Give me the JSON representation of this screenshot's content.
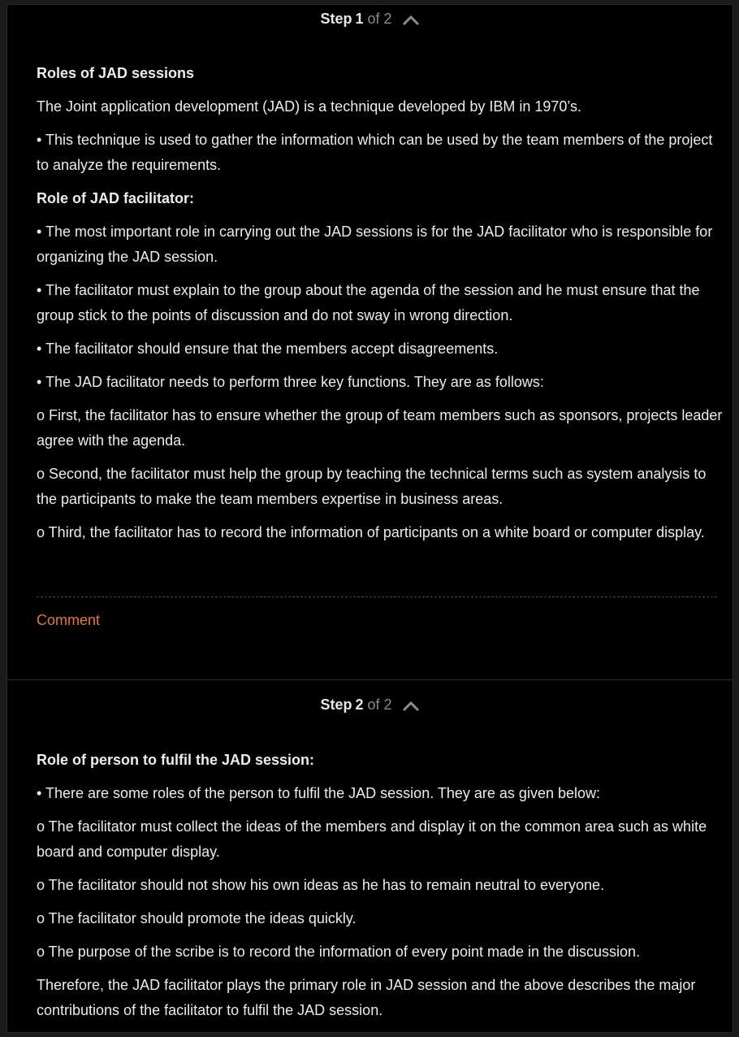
{
  "step1": {
    "step_word": "Step",
    "step_num": "1",
    "step_of": "of 2",
    "paragraphs": [
      {
        "text": "Roles of JAD sessions",
        "bold": true
      },
      {
        "text": "The Joint application development (JAD) is a technique developed by IBM in 1970’s.",
        "bold": false
      },
      {
        "text": "• This technique is used to gather the information which can be used by the team members of the project to analyze the requirements.",
        "bold": false
      },
      {
        "text": "Role of JAD facilitator:",
        "bold": true
      },
      {
        "text": "• The most important role in carrying out the JAD sessions is for the JAD facilitator who is responsible for organizing the JAD session.",
        "bold": false
      },
      {
        "text": "• The facilitator must explain to the group about the agenda of the session and he must ensure that the group stick to the points of discussion and do not sway in wrong direction.",
        "bold": false
      },
      {
        "text": "• The facilitator should ensure that the members accept disagreements.",
        "bold": false
      },
      {
        "text": "• The JAD facilitator needs to perform three key functions. They are as follows:",
        "bold": false
      },
      {
        "text": "o First, the facilitator has to ensure whether the group of team members such as sponsors, projects leader agree with the agenda.",
        "bold": false
      },
      {
        "text": "o Second, the facilitator must help the group by teaching the technical terms such as system analysis to the participants to make the team members expertise in business areas.",
        "bold": false
      },
      {
        "text": "o Third, the facilitator has to record the information of participants on a white board or computer display.",
        "bold": false
      }
    ],
    "comment_label": "Comment"
  },
  "step2": {
    "step_word": "Step",
    "step_num": "2",
    "step_of": "of 2",
    "paragraphs": [
      {
        "text": "Role of person to fulfil the JAD session:",
        "bold": true
      },
      {
        "text": "• There are some roles of the person to fulfil the JAD session. They are as given below:",
        "bold": false
      },
      {
        "text": "o The facilitator must collect the ideas of the members and display it on the common area such as white board and computer display.",
        "bold": false
      },
      {
        "text": "o The facilitator should not show his own ideas as he has to remain neutral to everyone.",
        "bold": false
      },
      {
        "text": "o The facilitator should promote the ideas quickly.",
        "bold": false
      },
      {
        "text": "o The purpose of the scribe is to record the information of every point made in the discussion.",
        "bold": false
      },
      {
        "text": "Therefore, the JAD facilitator plays the primary role in JAD session and the above describes the major contributions of the facilitator to fulfil the JAD session.",
        "bold": false
      }
    ]
  },
  "icons": {
    "collapse": "chevron-up-icon"
  },
  "colors": {
    "background": "#000000",
    "text": "#ececec",
    "muted": "#8c8c8c",
    "accent": "#e0784a"
  }
}
